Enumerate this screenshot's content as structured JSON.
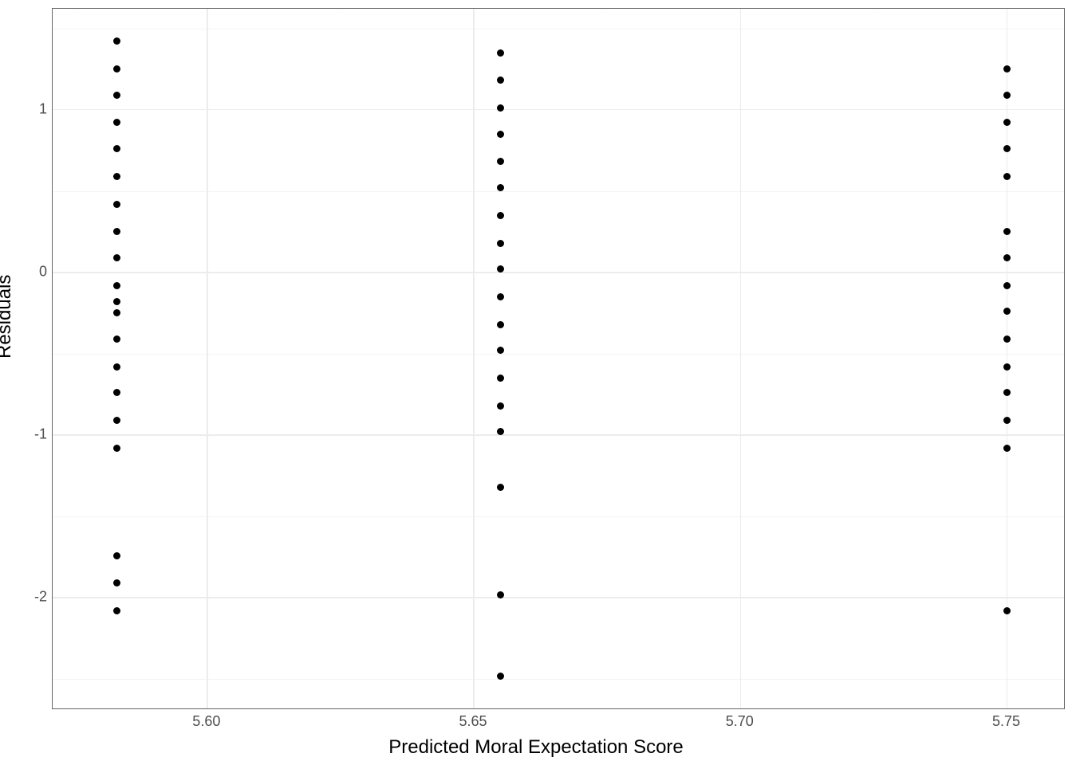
{
  "chart_data": {
    "type": "scatter",
    "xlabel": "Predicted Moral Expectation Score",
    "ylabel": "Residuals",
    "title": "",
    "xlim": [
      5.571,
      5.761
    ],
    "ylim": [
      -2.69,
      1.62
    ],
    "x_ticks": [
      5.6,
      5.65,
      5.7,
      5.75
    ],
    "y_ticks": [
      -2,
      -1,
      0,
      1
    ],
    "series": [
      {
        "name": "x≈5.583",
        "x": 5.583,
        "y": [
          1.42,
          1.25,
          1.09,
          0.92,
          0.76,
          0.59,
          0.42,
          0.25,
          0.09,
          -0.08,
          -0.18,
          -0.25,
          -0.41,
          -0.58,
          -0.74,
          -0.91,
          -1.08,
          -1.74,
          -1.91,
          -2.08
        ]
      },
      {
        "name": "x≈5.655",
        "x": 5.655,
        "y": [
          1.35,
          1.18,
          1.01,
          0.85,
          0.68,
          0.52,
          0.35,
          0.18,
          0.02,
          -0.15,
          -0.32,
          -0.48,
          -0.65,
          -0.82,
          -0.98,
          -1.32,
          -1.98,
          -2.48
        ]
      },
      {
        "name": "x≈5.750",
        "x": 5.75,
        "y": [
          1.25,
          1.09,
          0.92,
          0.76,
          0.59,
          0.25,
          0.09,
          -0.08,
          -0.24,
          -0.41,
          -0.58,
          -0.74,
          -0.91,
          -1.08,
          -2.08
        ]
      }
    ]
  }
}
